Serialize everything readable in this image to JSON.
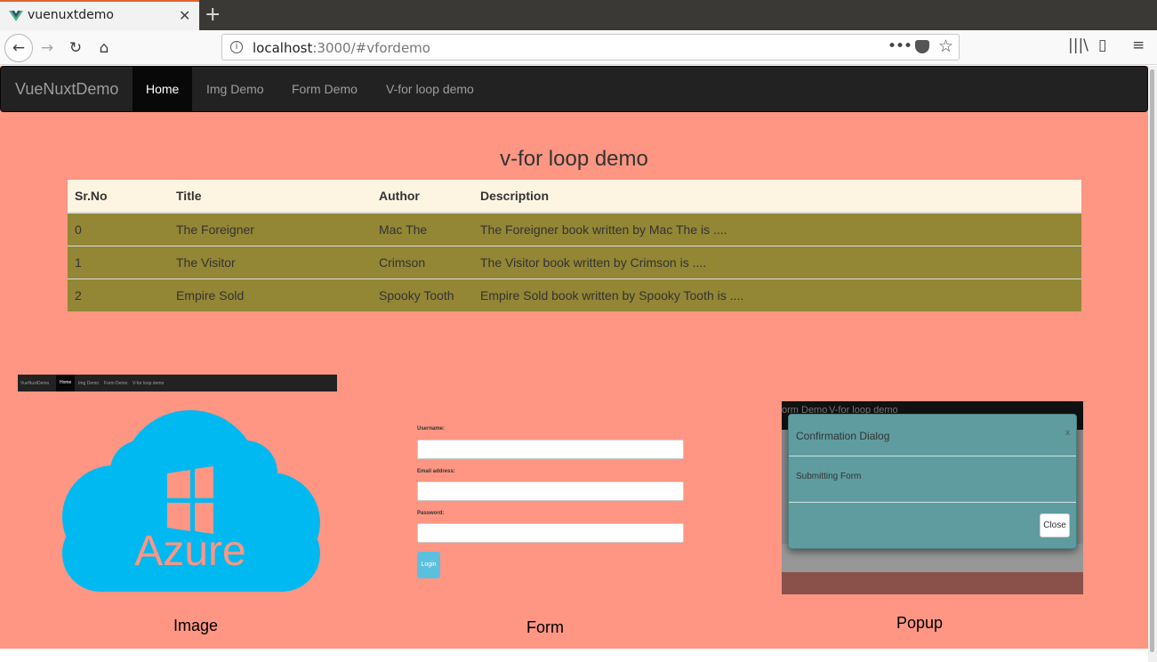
{
  "browser": {
    "tab_title": "vuenuxtdemo",
    "tab_close": "✕",
    "new_tab": "+",
    "url_host": "localhost",
    "url_rest": ":3000/#vfordemo",
    "url_more": "•••",
    "star": "☆",
    "back": "←",
    "forward": "→",
    "reload": "↻",
    "home": "⌂",
    "library": "|||\\",
    "sidebar": "▯",
    "menu": "≡",
    "info": "i"
  },
  "site_nav": {
    "brand": "VueNuxtDemo",
    "items": [
      {
        "label": "Home",
        "active": true
      },
      {
        "label": "Img Demo"
      },
      {
        "label": "Form Demo"
      },
      {
        "label": "V-for loop demo"
      }
    ]
  },
  "main": {
    "heading": "v-for loop demo",
    "table": {
      "headers": [
        "Sr.No",
        "Title",
        "Author",
        "Description"
      ],
      "rows": [
        [
          "0",
          "The Foreigner",
          "Mac The",
          "The Foreigner book written by Mac The is ...."
        ],
        [
          "1",
          "The Visitor",
          "Crimson",
          "The Visitor book written by Crimson is ...."
        ],
        [
          "2",
          "Empire Sold",
          "Spooky Tooth",
          "Empire Sold book written by Spooky Tooth is ...."
        ]
      ]
    }
  },
  "thumbnails": {
    "image": {
      "caption": "Image",
      "mini_nav": {
        "brand": "VueNuxtDemo",
        "items": [
          "Home",
          "Img Demo",
          "Form Demo",
          "V-for loop demo"
        ]
      },
      "logo_text": "Azure",
      "cloud_color": "#00b9f1"
    },
    "form": {
      "caption": "Form",
      "labels": [
        "Username:",
        "Email address:",
        "Password:"
      ],
      "button": "Login"
    },
    "popup": {
      "caption": "Popup",
      "topbar_items": [
        "orm Demo",
        "V-for loop demo"
      ],
      "dialog_title": "Confirmation Dialog",
      "dialog_x": "x",
      "dialog_body": "Submitting Form",
      "dialog_close": "Close"
    }
  },
  "colors": {
    "page_bg": "#fe9683",
    "nav_bg": "#222222",
    "table_header_bg": "#fdf5e2",
    "table_row_bg": "#938635"
  }
}
